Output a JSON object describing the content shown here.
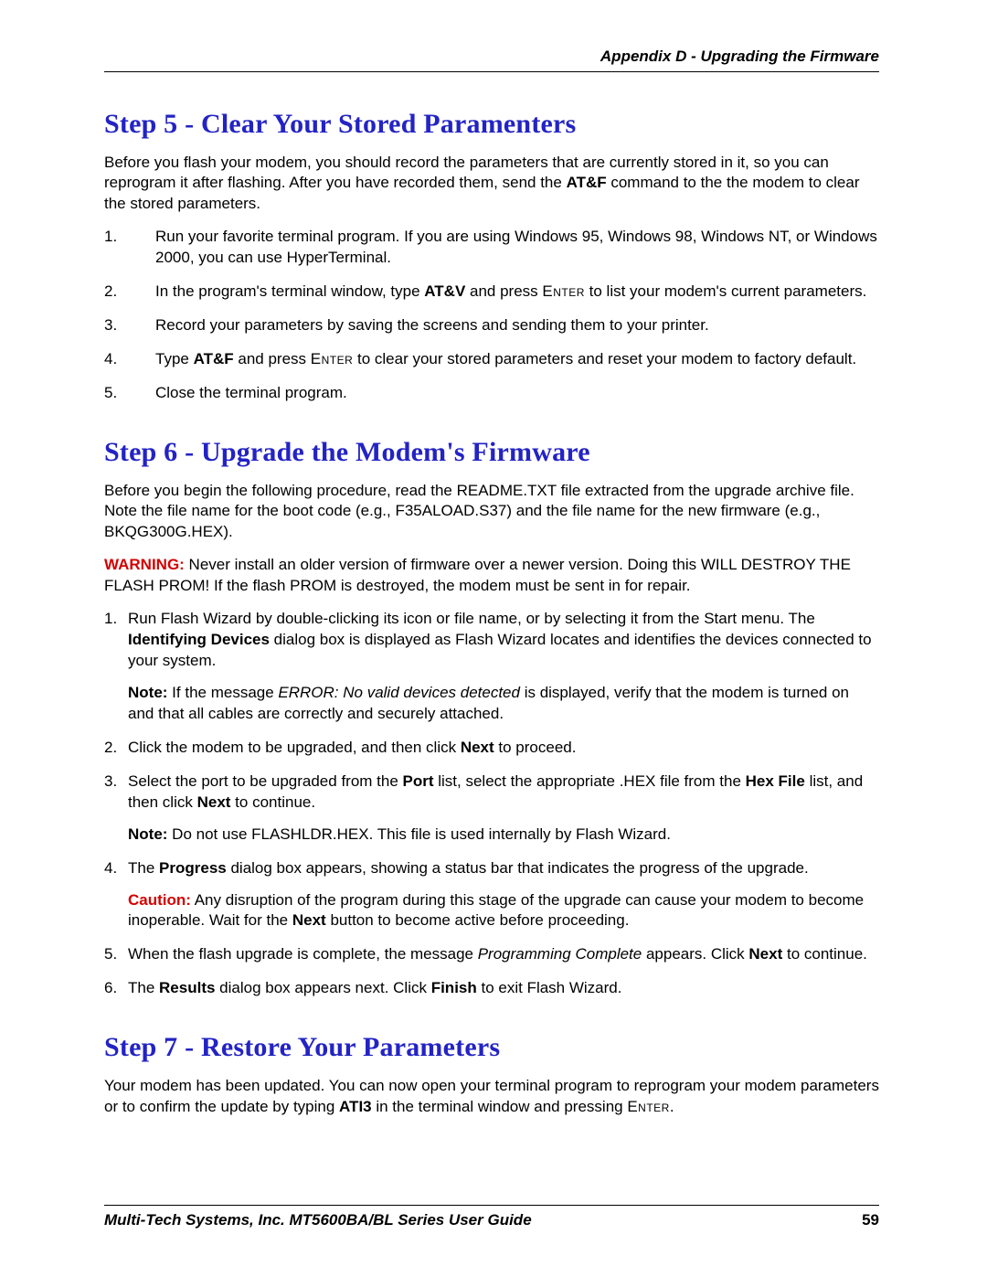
{
  "header": {
    "running": "Appendix D - Upgrading the Firmware"
  },
  "step5": {
    "title": "Step 5 - Clear Your Stored Paramenters",
    "intro_pre": "Before you flash your modem, you should record the parameters that are currently stored in it, so you can reprogram it after flashing. After you have recorded them, send the ",
    "intro_cmd": "AT&F",
    "intro_post": " command to the the modem to clear the stored parameters.",
    "items": {
      "i1": "Run your favorite terminal program. If you are using Windows 95, Windows 98, Windows NT,  or Windows 2000, you can use HyperTerminal.",
      "i2_pre": "In the program's terminal window, type ",
      "i2_cmd": "AT&V",
      "i2_mid": " and press ",
      "i2_enter": "Enter",
      "i2_post": " to list your modem's current parameters.",
      "i3": "Record your parameters by saving the screens and sending them to your printer.",
      "i4_pre": "Type ",
      "i4_cmd": "AT&F",
      "i4_mid": " and press ",
      "i4_enter": "Enter",
      "i4_post": " to clear your stored parameters and reset your modem to factory default.",
      "i5": "Close the terminal program."
    }
  },
  "step6": {
    "title": "Step 6 - Upgrade the Modem's Firmware",
    "intro": "Before you begin the following procedure, read the README.TXT file extracted from the upgrade archive file. Note the file name for the boot code (e.g., F35ALOAD.S37) and the file name for the new firmware (e.g., BKQG300G.HEX).",
    "warn_label": "WARNING:",
    "warn_text": " Never install an older version of firmware over a newer version. Doing this WILL DESTROY THE FLASH PROM! If the flash PROM is destroyed, the modem must be sent in for repair.",
    "items": {
      "i1_pre": "Run Flash Wizard by double-clicking its icon or file name, or by selecting it from the Start menu. The ",
      "i1_b": "Identifying Devices",
      "i1_post": " dialog box is displayed as Flash Wizard locates and identifies the devices connected to your system.",
      "i1_note_label": "Note:",
      "i1_note_pre": " If the message ",
      "i1_note_msg": "ERROR: No valid devices detected",
      "i1_note_post": " is displayed, verify that the modem is turned on and that all cables are correctly and securely attached.",
      "i2_pre": "Click the modem to be upgraded, and then click ",
      "i2_b": "Next",
      "i2_post": " to proceed.",
      "i3_pre": "Select the port to be upgraded from the ",
      "i3_b1": "Port",
      "i3_mid1": " list, select the appropriate .HEX file from the ",
      "i3_b2": "Hex File",
      "i3_mid2": " list, and then click ",
      "i3_b3": "Next",
      "i3_post": " to continue.",
      "i3_note_label": "Note:",
      "i3_note_text": " Do not use FLASHLDR.HEX. This file is used internally by Flash Wizard.",
      "i4_pre": "The ",
      "i4_b": "Progress",
      "i4_post": " dialog box appears, showing a status bar that indicates the progress of the upgrade.",
      "i4_caution_label": "Caution:",
      "i4_caution_pre": " Any disruption of the program during this stage of the upgrade can cause your modem to become inoperable. Wait for the ",
      "i4_caution_b": "Next",
      "i4_caution_post": " button to become active before proceeding.",
      "i5_pre": "When the flash upgrade is complete, the message ",
      "i5_msg": "Programming Complete",
      "i5_mid": " appears. Click ",
      "i5_b": "Next",
      "i5_post": " to continue.",
      "i6_pre": "The ",
      "i6_b1": "Results",
      "i6_mid": " dialog box appears next. Click ",
      "i6_b2": "Finish",
      "i6_post": " to exit Flash Wizard."
    }
  },
  "step7": {
    "title": "Step 7 - Restore Your Parameters",
    "body_pre": "Your modem has been updated. You can now open your terminal program to reprogram your modem parameters or to confirm the update by typing ",
    "body_cmd": "ATI3",
    "body_mid": " in the terminal window and pressing ",
    "body_enter": "Enter",
    "body_post": "."
  },
  "footer": {
    "text": "Multi-Tech Systems, Inc. MT5600BA/BL Series User Guide",
    "page": "59"
  }
}
